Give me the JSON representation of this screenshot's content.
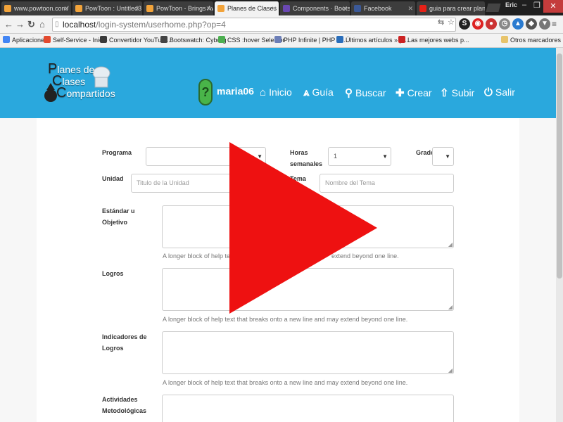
{
  "browser": {
    "tabs": [
      {
        "title": "www.powtoon.com/",
        "color": "#f2a33a"
      },
      {
        "title": "PowToon : Untitled3",
        "color": "#f2a33a"
      },
      {
        "title": "PowToon - Brings Aw",
        "color": "#f2a33a"
      },
      {
        "title": "Planes de Clases Com",
        "color": "#f2a33a"
      },
      {
        "title": "Components · Bootst",
        "color": "#6a48b3"
      },
      {
        "title": "Facebook",
        "color": "#3b5998"
      },
      {
        "title": "guia para crear plane",
        "color": "#e62117"
      }
    ],
    "user": "Eric",
    "url_host": "localhost",
    "url_path": "/login-system/userhome.php?op=4",
    "bookmarks": [
      {
        "label": "Aplicaciones",
        "color": "#4285f4"
      },
      {
        "label": "Self-Service - Inicio",
        "color": "#e34a2f"
      },
      {
        "label": "Convertidor YouTub...",
        "color": "#3a3a3a"
      },
      {
        "label": "Bootswatch: Cyborg",
        "color": "#444444"
      },
      {
        "label": "CSS :hover Selector",
        "color": "#4caf50"
      },
      {
        "label": "PHP Infinite | PHP In...",
        "color": "#6c7eb7"
      },
      {
        "label": "Últimos artículos » p...",
        "color": "#2a6ebb"
      },
      {
        "label": "Las mejores webs p...",
        "color": "#cc2222"
      },
      {
        "label": "Otros marcadores",
        "color": "#e8c46b"
      }
    ]
  },
  "site": {
    "logo_lines": [
      "lanes de",
      "lases",
      "ompartidos"
    ],
    "logo_caps": [
      "P",
      "C",
      "C"
    ],
    "nav": {
      "user": "maria06",
      "inicio": "Inicio",
      "guia": "Guía",
      "buscar": "Buscar",
      "crear": "Crear",
      "subir": "Subir",
      "salir": "Salir"
    },
    "colors": {
      "header": "#2aa8dd",
      "play": "#ee1111"
    }
  },
  "form": {
    "programa_label": "Programa",
    "horas_label_1": "Horas",
    "horas_label_2": "semanales",
    "horas_value": "1",
    "grado_label": "Grado",
    "unidad_label": "Unidad",
    "unidad_placeholder": "Titulo de la Unidad",
    "tema_label": "Tema",
    "tema_placeholder": "Nombre del Tema",
    "estandar_label_1": "Estándar u",
    "estandar_label_2": "Objetivo",
    "logros_label": "Logros",
    "indicadores_label_1": "Indicadores de",
    "indicadores_label_2": "Logros",
    "actividades_label_1": "Actividades",
    "actividades_label_2": "Metodológicas",
    "help_text": "A longer block of help text that breaks onto a new line and may extend beyond one line.",
    "help_partial_start": "A longer block of help text",
    "help_partial_end": "extend beyond one line."
  }
}
